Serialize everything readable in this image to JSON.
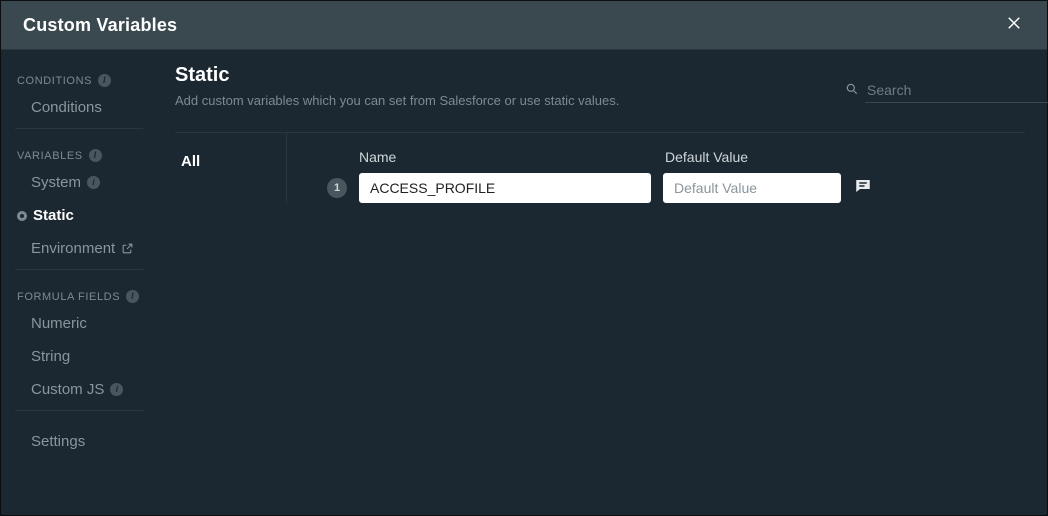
{
  "header": {
    "title": "Custom Variables"
  },
  "sidebar": {
    "groups": [
      {
        "heading": "CONDITIONS",
        "info": true,
        "items": [
          {
            "label": "Conditions",
            "active": false
          }
        ]
      },
      {
        "heading": "VARIABLES",
        "info": true,
        "items": [
          {
            "label": "System",
            "info": true
          },
          {
            "label": "Static",
            "active": true
          },
          {
            "label": "Environment",
            "external": true
          }
        ]
      },
      {
        "heading": "FORMULA FIELDS",
        "info": true,
        "items": [
          {
            "label": "Numeric"
          },
          {
            "label": "String"
          },
          {
            "label": "Custom JS",
            "info": true
          }
        ]
      }
    ],
    "settings": {
      "label": "Settings"
    }
  },
  "pane": {
    "title": "Static",
    "description": "Add custom variables which you can set from Salesforce or use static values.",
    "search": {
      "placeholder": "Search"
    },
    "subnav": {
      "all": "All"
    },
    "columns": {
      "name": "Name",
      "default_value": "Default Value"
    },
    "rows": [
      {
        "num": "1",
        "name": "ACCESS_PROFILE",
        "default_value": "",
        "default_placeholder": "Default Value"
      }
    ]
  }
}
